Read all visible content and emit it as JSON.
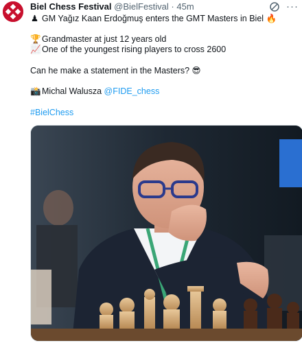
{
  "tweet": {
    "display_name": "Biel Chess Festival",
    "handle": "@BielFestival",
    "separator": "·",
    "time": "45m",
    "lines": {
      "line1": "GM Yağız Kaan Erdoğmuş enters the GMT Masters in Biel",
      "line2": "Grandmaster at just 12 years old",
      "line3": "One of the youngest rising players to cross 2600",
      "line4": "Can he make a statement in the Masters?",
      "credit_name": "Michal Walusza",
      "credit_handle": "@FIDE_chess",
      "hashtag": "#BielChess"
    },
    "emojis": {
      "pawn": "♟",
      "fire": "🔥",
      "trophy": "🏆",
      "chart": "📈",
      "cool": "😎",
      "camera": "📸"
    }
  },
  "icons": {
    "top_left_icon": "slash-circle-icon",
    "top_right_icon": "more-icon"
  },
  "colors": {
    "accent": "#1d9bf0",
    "avatar_red": "#c8102e",
    "text_primary": "#0f1419",
    "text_secondary": "#536471"
  }
}
